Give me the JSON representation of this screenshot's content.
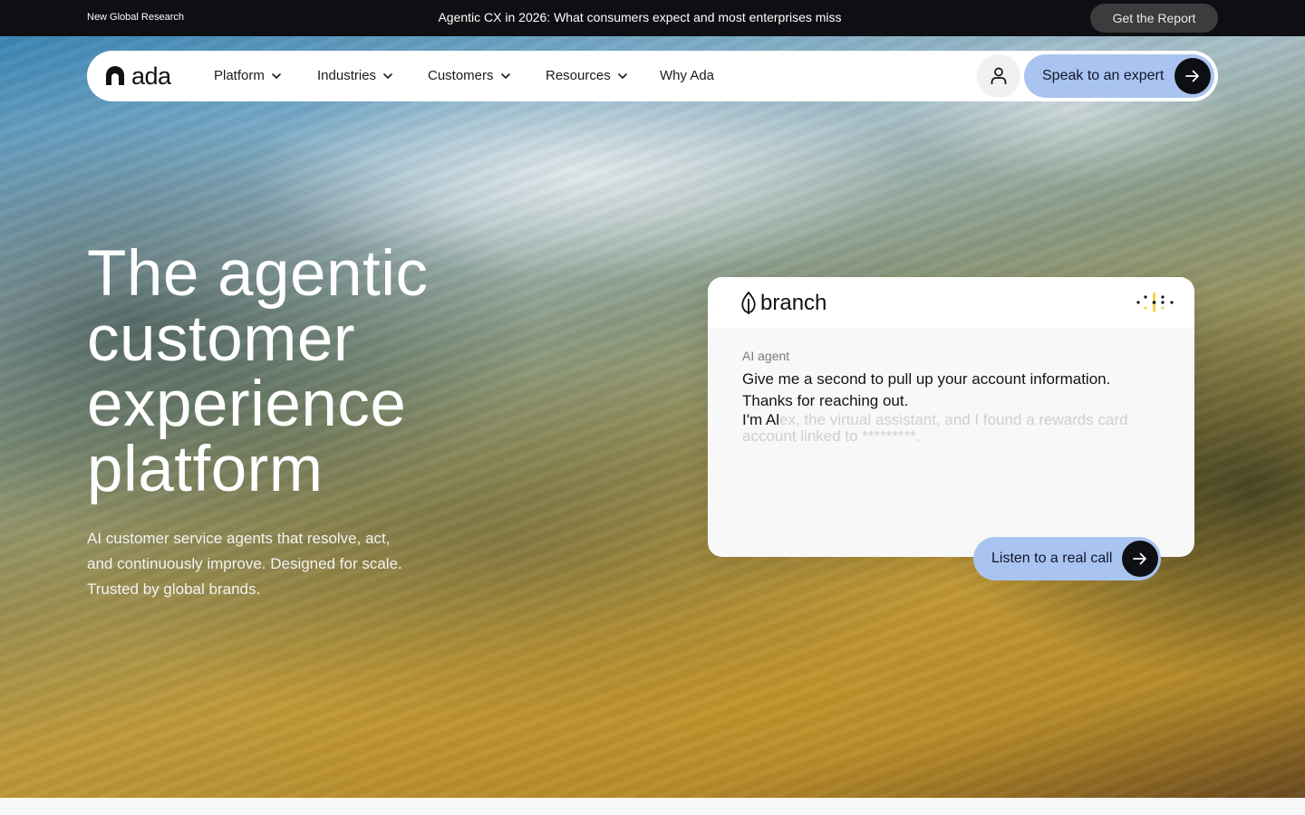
{
  "announcement": {
    "kicker": "New Global Research",
    "headline": "Agentic CX in 2026: What consumers expect and most enterprises miss",
    "cta_label": "Get the Report"
  },
  "nav": {
    "logo_text": "ada",
    "items": [
      {
        "label": "Platform",
        "has_dropdown": true
      },
      {
        "label": "Industries",
        "has_dropdown": true
      },
      {
        "label": "Customers",
        "has_dropdown": true
      },
      {
        "label": "Resources",
        "has_dropdown": true
      },
      {
        "label": "Why Ada",
        "has_dropdown": false
      }
    ],
    "account_icon": "user-icon",
    "cta_label": "Speak to an expert",
    "cta_icon": "arrow-right-icon"
  },
  "hero": {
    "title_lines": [
      "The agentic",
      "customer",
      "experience",
      "platform"
    ],
    "subtitle": "AI customer service agents that resolve, act, and continuously improve. Designed for scale. Trusted by global brands."
  },
  "chat_demo": {
    "brand_name": "branch",
    "brand_icon": "leaf-icon",
    "voice_icon": "audio-wave-icon",
    "role_label": "AI agent",
    "messages": [
      "Give me a second to pull up your account information.",
      "Thanks for reaching out."
    ],
    "typing_visible": "I'm Al",
    "typing_pending": "ex, the virtual assistant, and I found a rewards card account linked to *********.",
    "cta_label": "Listen to a real call",
    "cta_icon": "arrow-right-icon"
  },
  "colors": {
    "announcement_bg": "#0d0f12",
    "accent_button": "#a9c4f0",
    "arrow_circle": "#0d0f12",
    "wave_accent": "#f3d54a"
  }
}
